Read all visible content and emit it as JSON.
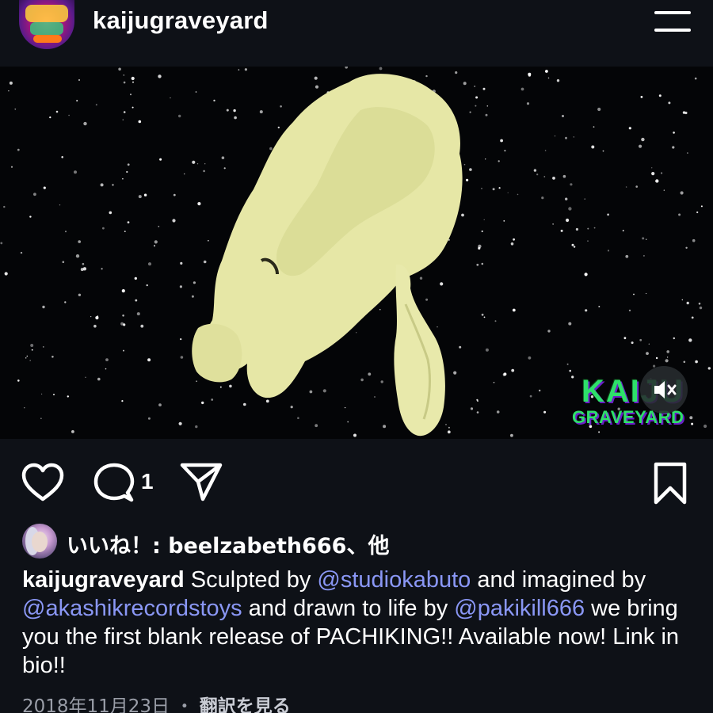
{
  "header": {
    "username": "kaijugraveyard",
    "avatar_icon": "kaiju-graveyard-logo-avatar",
    "menu_icon": "hamburger-menu-icon"
  },
  "media": {
    "watermark_top": "KAIJU",
    "watermark_bottom": "GRAVEYARD",
    "mute_icon": "speaker-muted-icon"
  },
  "actions": {
    "like_icon": "heart-icon",
    "comment_icon": "comment-bubble-icon",
    "comment_count": "1",
    "share_icon": "paper-plane-icon",
    "save_icon": "bookmark-icon"
  },
  "likes": {
    "text": "いいね！: beelzabeth666、他"
  },
  "caption": {
    "owner": "kaijugraveyard",
    "part1": " Sculpted by ",
    "mention1": "@studiokabuto",
    "part2": " and imagined by ",
    "mention2": "@akashikrecordstoys",
    "part3": " and drawn to life by ",
    "mention3": "@pakikill666",
    "part4": " we bring you the first blank release of PACHIKING!! Available now! Link in bio!!"
  },
  "footer": {
    "date": "2018年11月23日",
    "separator": " ・ ",
    "translate_label": "翻訳を見る"
  },
  "colors": {
    "background": "#0e1117",
    "mention": "#8a97f5",
    "watermark": "#2ee06a",
    "figure": "#e6e7a6"
  }
}
